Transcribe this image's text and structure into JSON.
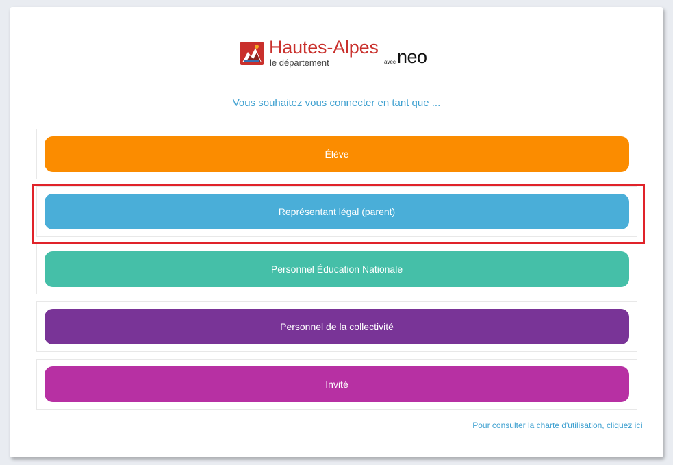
{
  "logo": {
    "title": "Hautes-Alpes",
    "subtitle": "le département",
    "avec": "avec",
    "brand": "neo",
    "title_color": "#c9302c"
  },
  "prompt": "Vous souhaitez vous connecter en tant que ...",
  "roles": [
    {
      "label": "Élève",
      "color": "#fb8c00"
    },
    {
      "label": "Représentant légal (parent)",
      "color": "#4aaed8",
      "highlighted": true
    },
    {
      "label": "Personnel Éducation Nationale",
      "color": "#45bfa8"
    },
    {
      "label": "Personnel de la collectivité",
      "color": "#793497"
    },
    {
      "label": "Invité",
      "color": "#b730a3"
    }
  ],
  "highlight_color": "#e0232a",
  "charter_link": "Pour consulter la charte d'utilisation, cliquez ici",
  "link_color": "#3ea0d0"
}
